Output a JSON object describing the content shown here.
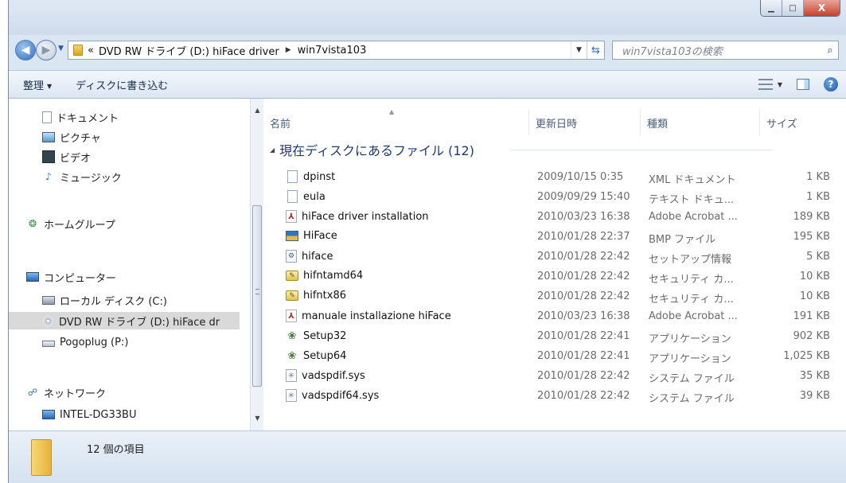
{
  "window": {
    "minimize_glyph": "▁",
    "maximize_glyph": "□",
    "close_glyph": "X"
  },
  "address": {
    "overflow": "«",
    "crumbs": [
      "DVD RW ドライブ (D:) hiFace driver",
      "win7vista103"
    ]
  },
  "search": {
    "placeholder": "win7vista103の検索"
  },
  "toolbar": {
    "organize": "整理",
    "burn": "ディスクに書き込む"
  },
  "nav": {
    "items": [
      {
        "label": "ドキュメント",
        "icon": "document-icon"
      },
      {
        "label": "ピクチャ",
        "icon": "pictures-icon"
      },
      {
        "label": "ビデオ",
        "icon": "video-icon"
      },
      {
        "label": "ミュージック",
        "icon": "music-icon"
      },
      {
        "label": "ホームグループ",
        "icon": "homegroup-icon"
      },
      {
        "label": "コンピューター",
        "icon": "computer-icon"
      },
      {
        "label": "ローカル ディスク (C:)",
        "icon": "local-disk-icon"
      },
      {
        "label": "DVD RW ドライブ (D:) hiFace dr",
        "icon": "dvd-drive-icon"
      },
      {
        "label": "Pogoplug (P:)",
        "icon": "network-drive-icon"
      },
      {
        "label": "ネットワーク",
        "icon": "network-icon"
      },
      {
        "label": "INTEL-DG33BU",
        "icon": "computer-icon"
      }
    ]
  },
  "columns": {
    "name": "名前",
    "date": "更新日時",
    "type": "種類",
    "size": "サイズ"
  },
  "group": {
    "title": "現在ディスクにあるファイル (12)"
  },
  "files": [
    {
      "name": "dpinst",
      "date": "2009/10/15 0:35",
      "type": "XML ドキュメント",
      "size": "1 KB",
      "icon": "xml-file-icon"
    },
    {
      "name": "eula",
      "date": "2009/09/29 15:40",
      "type": "テキスト ドキュ...",
      "size": "1 KB",
      "icon": "text-file-icon"
    },
    {
      "name": "hiFace driver installation",
      "date": "2010/03/23 16:38",
      "type": "Adobe Acrobat ...",
      "size": "189 KB",
      "icon": "pdf-file-icon"
    },
    {
      "name": "HiFace",
      "date": "2010/01/28 22:37",
      "type": "BMP ファイル",
      "size": "195 KB",
      "icon": "bmp-file-icon"
    },
    {
      "name": "hiface",
      "date": "2010/01/28 22:42",
      "type": "セットアップ情報",
      "size": "5 KB",
      "icon": "setup-info-icon"
    },
    {
      "name": "hifntamd64",
      "date": "2010/01/28 22:42",
      "type": "セキュリティ カ...",
      "size": "10 KB",
      "icon": "security-catalog-icon"
    },
    {
      "name": "hifntx86",
      "date": "2010/01/28 22:42",
      "type": "セキュリティ カ...",
      "size": "10 KB",
      "icon": "security-catalog-icon"
    },
    {
      "name": "manuale installazione hiFace",
      "date": "2010/03/23 16:38",
      "type": "Adobe Acrobat ...",
      "size": "191 KB",
      "icon": "pdf-file-icon"
    },
    {
      "name": "Setup32",
      "date": "2010/01/28 22:41",
      "type": "アプリケーション",
      "size": "902 KB",
      "icon": "application-icon"
    },
    {
      "name": "Setup64",
      "date": "2010/01/28 22:41",
      "type": "アプリケーション",
      "size": "1,025 KB",
      "icon": "application-icon"
    },
    {
      "name": "vadspdif.sys",
      "date": "2010/01/28 22:42",
      "type": "システム ファイル",
      "size": "35 KB",
      "icon": "system-file-icon"
    },
    {
      "name": "vadspdif64.sys",
      "date": "2010/01/28 22:42",
      "type": "システム ファイル",
      "size": "39 KB",
      "icon": "system-file-icon"
    }
  ],
  "status": {
    "text": "12 個の項目"
  }
}
